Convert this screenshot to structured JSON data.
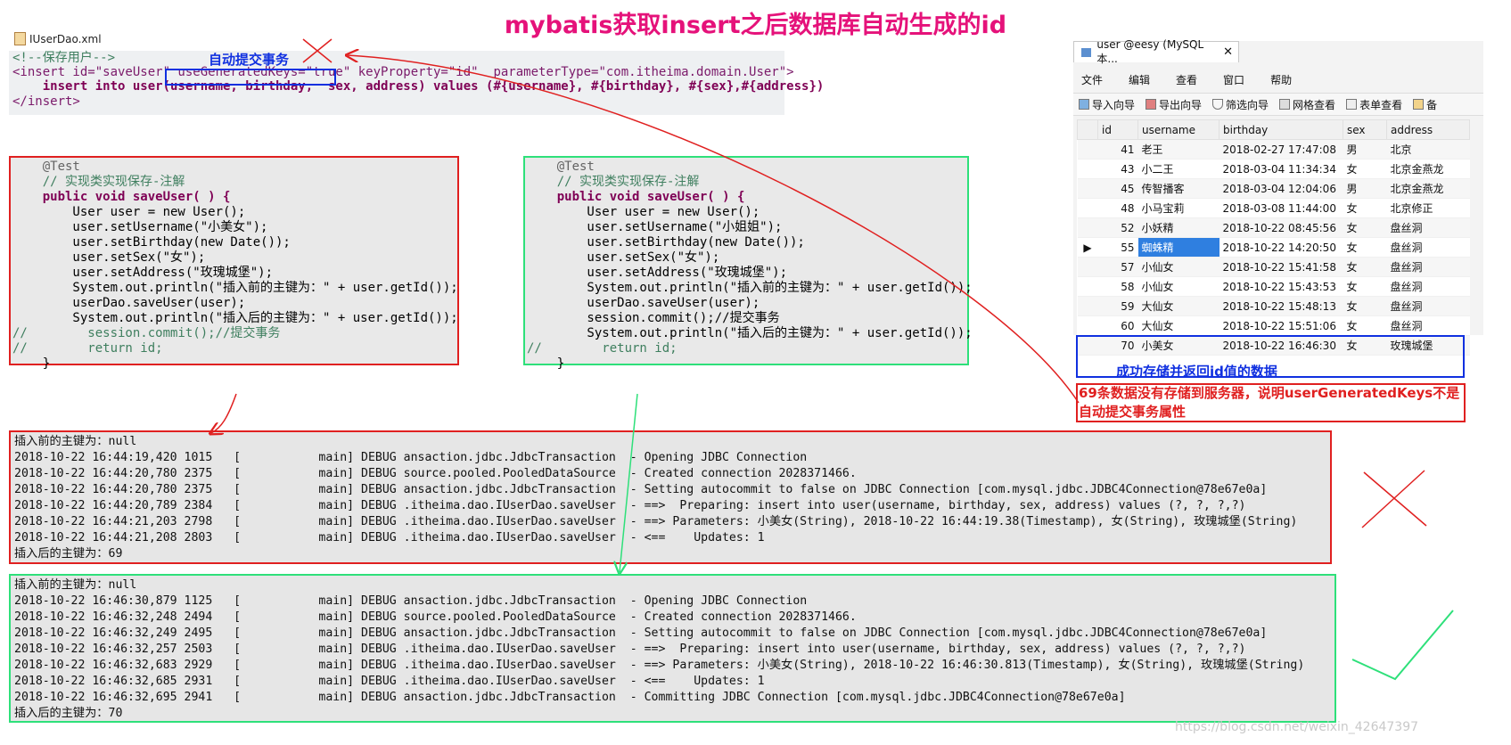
{
  "title": "mybatis获取insert之后数据库自动生成的id",
  "xml": {
    "file_tab": "IUserDao.xml",
    "note": "自动提交事务",
    "lines": [
      "<!--保存用户-->",
      "<insert id=\"saveUser\" useGeneratedKeys=\"true\" keyProperty=\"id\"  parameterType=\"com.itheima.domain.User\">",
      "    insert into user(username, birthday,  sex, address) values (#{username}, #{birthday}, #{sex},#{address})",
      "</insert>"
    ]
  },
  "code_left": {
    "lines": [
      "    @Test",
      "    // 实现类实现保存-注解",
      "    public void saveUser( ) {",
      "        User user = new User();",
      "        user.setUsername(\"小美女\");",
      "        user.setBirthday(new Date());",
      "        user.setSex(\"女\");",
      "        user.setAddress(\"玫瑰城堡\");",
      "        System.out.println(\"插入前的主键为：\" + user.getId());",
      "        userDao.saveUser(user);",
      "        System.out.println(\"插入后的主键为：\" + user.getId());",
      "//        session.commit();//提交事务",
      "//        return id;",
      "    }"
    ]
  },
  "code_right": {
    "lines": [
      "    @Test",
      "    // 实现类实现保存-注解",
      "    public void saveUser( ) {",
      "        User user = new User();",
      "        user.setUsername(\"小姐姐\");",
      "        user.setBirthday(new Date());",
      "        user.setSex(\"女\");",
      "        user.setAddress(\"玫瑰城堡\");",
      "        System.out.println(\"插入前的主键为：\" + user.getId());",
      "        userDao.saveUser(user);",
      "        session.commit();//提交事务",
      "        System.out.println(\"插入后的主键为：\" + user.getId());",
      "//        return id;",
      "    }"
    ]
  },
  "log_top": {
    "lines": [
      "插入前的主键为：null",
      "2018-10-22 16:44:19,420 1015   [           main] DEBUG ansaction.jdbc.JdbcTransaction  - Opening JDBC Connection",
      "2018-10-22 16:44:20,780 2375   [           main] DEBUG source.pooled.PooledDataSource  - Created connection 2028371466.",
      "2018-10-22 16:44:20,780 2375   [           main] DEBUG ansaction.jdbc.JdbcTransaction  - Setting autocommit to false on JDBC Connection [com.mysql.jdbc.JDBC4Connection@78e67e0a]",
      "2018-10-22 16:44:20,789 2384   [           main] DEBUG .itheima.dao.IUserDao.saveUser  - ==>  Preparing: insert into user(username, birthday, sex, address) values (?, ?, ?,?)",
      "2018-10-22 16:44:21,203 2798   [           main] DEBUG .itheima.dao.IUserDao.saveUser  - ==> Parameters: 小美女(String), 2018-10-22 16:44:19.38(Timestamp), 女(String), 玫瑰城堡(String)",
      "2018-10-22 16:44:21,208 2803   [           main] DEBUG .itheima.dao.IUserDao.saveUser  - <==    Updates: 1",
      "插入后的主键为：69"
    ]
  },
  "log_bottom": {
    "lines": [
      "插入前的主键为：null",
      "2018-10-22 16:46:30,879 1125   [           main] DEBUG ansaction.jdbc.JdbcTransaction  - Opening JDBC Connection",
      "2018-10-22 16:46:32,248 2494   [           main] DEBUG source.pooled.PooledDataSource  - Created connection 2028371466.",
      "2018-10-22 16:46:32,249 2495   [           main] DEBUG ansaction.jdbc.JdbcTransaction  - Setting autocommit to false on JDBC Connection [com.mysql.jdbc.JDBC4Connection@78e67e0a]",
      "2018-10-22 16:46:32,257 2503   [           main] DEBUG .itheima.dao.IUserDao.saveUser  - ==>  Preparing: insert into user(username, birthday, sex, address) values (?, ?, ?,?)",
      "2018-10-22 16:46:32,683 2929   [           main] DEBUG .itheima.dao.IUserDao.saveUser  - ==> Parameters: 小美女(String), 2018-10-22 16:46:30.813(Timestamp), 女(String), 玫瑰城堡(String)",
      "2018-10-22 16:46:32,685 2931   [           main] DEBUG .itheima.dao.IUserDao.saveUser  - <==    Updates: 1",
      "2018-10-22 16:46:32,695 2941   [           main] DEBUG ansaction.jdbc.JdbcTransaction  - Committing JDBC Connection [com.mysql.jdbc.JDBC4Connection@78e67e0a]",
      "插入后的主键为：70"
    ]
  },
  "db": {
    "tab_title": "user @eesy (MySQL本...",
    "tab_close": "✕",
    "menu": [
      "文件",
      "编辑",
      "查看",
      "窗口",
      "帮助"
    ],
    "toolbar": [
      "导入向导",
      "导出向导",
      "筛选向导",
      "网格查看",
      "表单查看",
      "备"
    ],
    "columns": [
      "id",
      "username",
      "birthday",
      "sex",
      "address"
    ],
    "rows": [
      [
        "41",
        "老王",
        "2018-02-27 17:47:08",
        "男",
        "北京"
      ],
      [
        "43",
        "小二王",
        "2018-03-04 11:34:34",
        "女",
        "北京金燕龙"
      ],
      [
        "45",
        "传智播客",
        "2018-03-04 12:04:06",
        "男",
        "北京金燕龙"
      ],
      [
        "48",
        "小马宝莉",
        "2018-03-08 11:44:00",
        "女",
        "北京修正"
      ],
      [
        "52",
        "小妖精",
        "2018-10-22 08:45:56",
        "女",
        "盘丝洞"
      ],
      [
        "55",
        "蜘蛛精",
        "2018-10-22 14:20:50",
        "女",
        "盘丝洞"
      ],
      [
        "57",
        "小仙女",
        "2018-10-22 15:41:58",
        "女",
        "盘丝洞"
      ],
      [
        "58",
        "小仙女",
        "2018-10-22 15:43:53",
        "女",
        "盘丝洞"
      ],
      [
        "59",
        "大仙女",
        "2018-10-22 15:48:13",
        "女",
        "盘丝洞"
      ],
      [
        "60",
        "大仙女",
        "2018-10-22 15:51:06",
        "女",
        "盘丝洞"
      ],
      [
        "70",
        "小美女",
        "2018-10-22 16:46:30",
        "女",
        "玫瑰城堡"
      ]
    ],
    "success_note": "成功存储并返回id值的数据",
    "warning_note": "69条数据没有存储到服务器，说明userGeneratedKeys不是自动提交事务属性"
  },
  "watermark": "https://blog.csdn.net/weixin_42647397",
  "colors": {
    "title": "#e5127a",
    "red": "#e02020",
    "green": "#2ee07a",
    "blue": "#1030e0"
  }
}
